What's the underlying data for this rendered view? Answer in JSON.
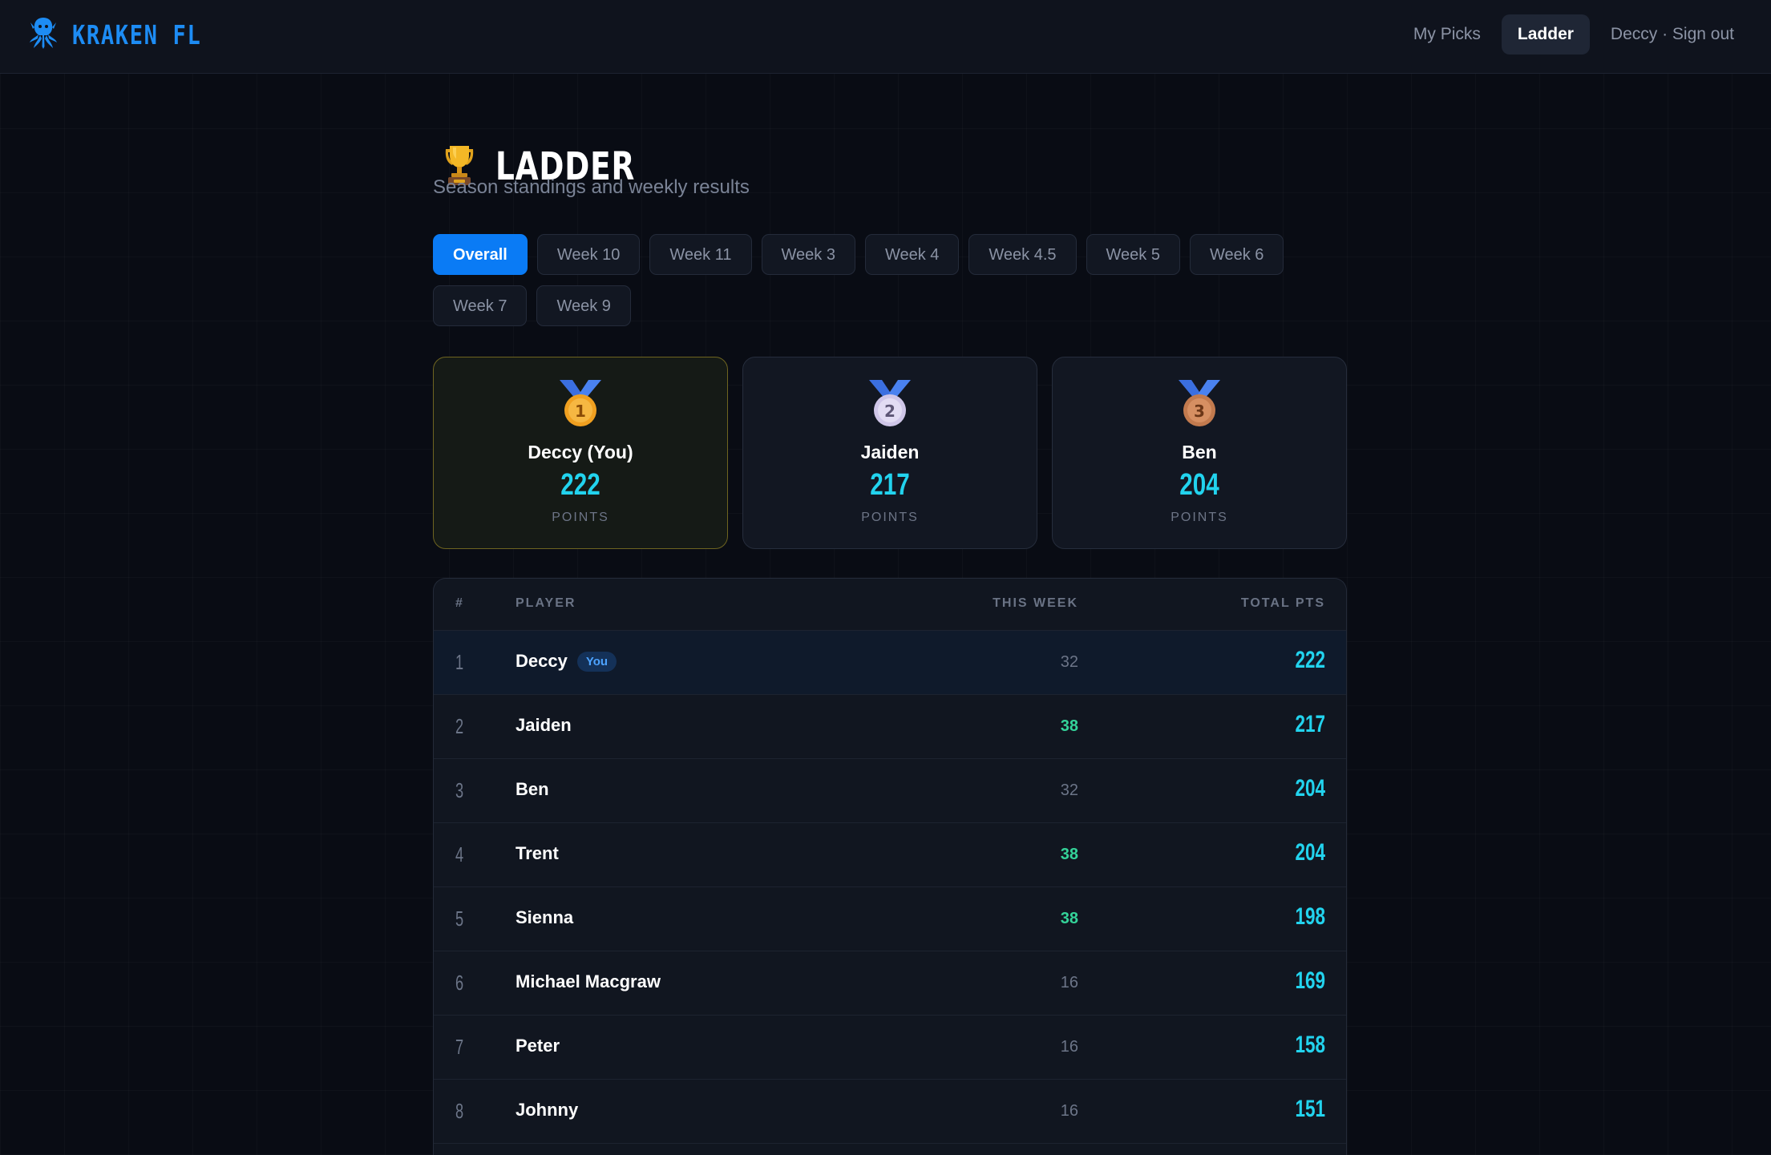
{
  "app": {
    "brand": "KRAKEN FL",
    "brand_icon": "kraken-icon",
    "accent_color": "#1d8cf4"
  },
  "nav": {
    "items": [
      {
        "label": "My Picks",
        "active": false
      },
      {
        "label": "Ladder",
        "active": true
      },
      {
        "label": "Deccy · Sign out",
        "active": false
      }
    ]
  },
  "page": {
    "icon": "trophy-icon",
    "title": "LADDER",
    "subtitle": "Season standings and weekly results"
  },
  "tabs": [
    {
      "label": "Overall",
      "active": true
    },
    {
      "label": "Week 10",
      "active": false
    },
    {
      "label": "Week 11",
      "active": false
    },
    {
      "label": "Week 3",
      "active": false
    },
    {
      "label": "Week 4",
      "active": false
    },
    {
      "label": "Week 4.5",
      "active": false
    },
    {
      "label": "Week 5",
      "active": false
    },
    {
      "label": "Week 6",
      "active": false
    },
    {
      "label": "Week 7",
      "active": false
    },
    {
      "label": "Week 9",
      "active": false
    }
  ],
  "podium": [
    {
      "place": "1",
      "name": "Deccy (You)",
      "points": "222",
      "label": "POINTS",
      "medal": "gold-medal-icon",
      "medal_color": "#f0a020"
    },
    {
      "place": "2",
      "name": "Jaiden",
      "points": "217",
      "label": "POINTS",
      "medal": "silver-medal-icon",
      "medal_color": "#cfc6e8"
    },
    {
      "place": "3",
      "name": "Ben",
      "points": "204",
      "label": "POINTS",
      "medal": "bronze-medal-icon",
      "medal_color": "#c27a4e"
    }
  ],
  "table": {
    "headers": {
      "rank": "#",
      "player": "PLAYER",
      "week": "THIS WEEK",
      "total": "TOTAL PTS"
    },
    "you_badge": "You",
    "rows": [
      {
        "rank": "1",
        "player": "Deccy",
        "you": true,
        "week": "32",
        "week_up": false,
        "total": "222"
      },
      {
        "rank": "2",
        "player": "Jaiden",
        "you": false,
        "week": "38",
        "week_up": true,
        "total": "217"
      },
      {
        "rank": "3",
        "player": "Ben",
        "you": false,
        "week": "32",
        "week_up": false,
        "total": "204"
      },
      {
        "rank": "4",
        "player": "Trent",
        "you": false,
        "week": "38",
        "week_up": true,
        "total": "204"
      },
      {
        "rank": "5",
        "player": "Sienna",
        "you": false,
        "week": "38",
        "week_up": true,
        "total": "198"
      },
      {
        "rank": "6",
        "player": "Michael Macgraw",
        "you": false,
        "week": "16",
        "week_up": false,
        "total": "169"
      },
      {
        "rank": "7",
        "player": "Peter",
        "you": false,
        "week": "16",
        "week_up": false,
        "total": "158"
      },
      {
        "rank": "8",
        "player": "Johnny",
        "you": false,
        "week": "16",
        "week_up": false,
        "total": "151"
      }
    ]
  }
}
